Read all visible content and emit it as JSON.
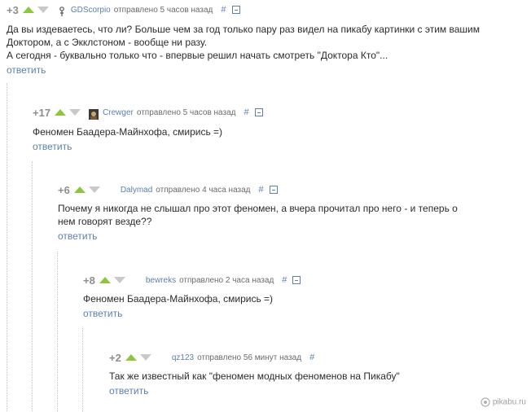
{
  "comments": [
    {
      "rating": "+3",
      "author": "GDScorpio",
      "meta": "отправлено 5 часов назад",
      "hash": "#",
      "lines": [
        "Да вы издеваетесь, что ли? Больше чем за год только пару раз видел на пикабу картинки с этим вашим",
        "Доктором, а с Экклстоном - вообще ни разу.",
        "А сегодня - буквально только что - впервые решил начать смотреть \"Доктора Кто\"..."
      ],
      "reply": "ответить"
    },
    {
      "rating": "+17",
      "author": "Crewger",
      "meta": "отправлено 5 часов назад",
      "hash": "#",
      "lines": [
        "Феномен Баадера-Майнхофа, смирись =)"
      ],
      "reply": "ответить"
    },
    {
      "rating": "+6",
      "author": "Dalymad",
      "meta": "отправлено 4 часа назад",
      "hash": "#",
      "lines": [
        "Почему я никогда не слышал про этот феномен, а вчера прочитал про него - и теперь о",
        "нем говорят везде??"
      ],
      "reply": "ответить"
    },
    {
      "rating": "+8",
      "author": "bewreks",
      "meta": "отправлено 2 часа назад",
      "hash": "#",
      "lines": [
        "Феномен Баадера-Майнхофа, смирись =)"
      ],
      "reply": "ответить"
    },
    {
      "rating": "+2",
      "author": "qz123",
      "meta": "отправлено 56 минут назад",
      "hash": "#",
      "lines": [
        "Так же известный как \"феномен модных феноменов на Пикабу\""
      ],
      "reply": "ответить"
    }
  ],
  "watermark": "pikabu.ru",
  "colors": {
    "link": "#5c7fae",
    "up_arrow": "#8cc63f",
    "down_arrow": "#c9c9c9"
  }
}
